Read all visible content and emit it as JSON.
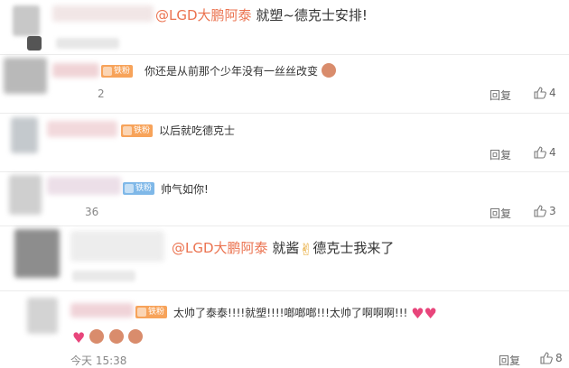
{
  "comments": [
    {
      "mention": "@LGD大鹏阿泰",
      "text": "就塑~德克士安排!"
    },
    {
      "badge": "铁粉",
      "text": "你还是从前那个少年没有一丝丝改变",
      "meta_fragment": "2",
      "reply_label": "回复",
      "likes": "4"
    },
    {
      "badge": "铁粉",
      "text": "以后就吃德克士",
      "reply_label": "回复",
      "likes": "4"
    },
    {
      "badge": "铁粉",
      "text": "帅气如你!",
      "meta_fragment": "36",
      "reply_label": "回复",
      "likes": "3"
    },
    {
      "mention": "@LGD大鹏阿泰",
      "text_before": "就酱",
      "text_after": "德克士我来了"
    },
    {
      "badge": "铁粉",
      "text": "太帅了泰泰!!!!就塑!!!!啷啷啷!!!太帅了啊啊啊!!!",
      "timestamp": "今天 15:38",
      "reply_label": "回复",
      "likes": "8"
    }
  ],
  "icons": {
    "like": "thumbs-up-icon",
    "heart": "heart-emoji-icon",
    "face": "face-emoji-icon",
    "victory": "victory-hand-emoji-icon"
  },
  "colors": {
    "mention": "#eb7350",
    "fan_badge": "#f7a35a",
    "blue_badge": "#7fb8e8",
    "meta_text": "#666666"
  }
}
